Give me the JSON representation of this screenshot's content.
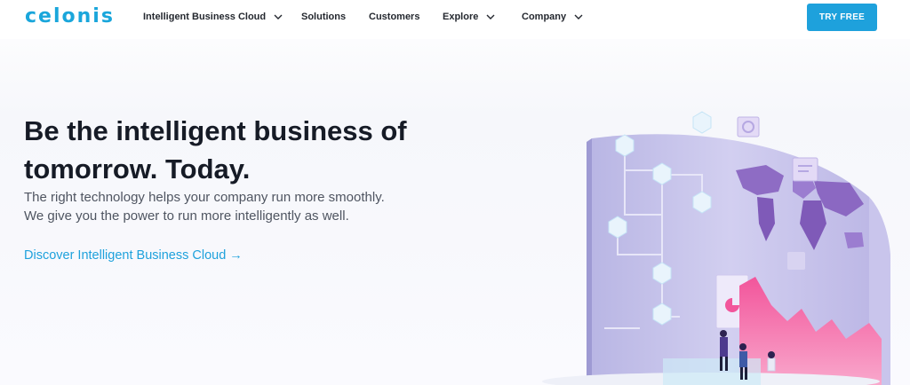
{
  "brand": {
    "logo_text": "celonis",
    "accent": "#1ea1dc"
  },
  "nav": {
    "items": [
      {
        "label": "Intelligent Business Cloud",
        "has_dropdown": true
      },
      {
        "label": "Solutions",
        "has_dropdown": false
      },
      {
        "label": "Customers",
        "has_dropdown": false
      },
      {
        "label": "Explore",
        "has_dropdown": true
      },
      {
        "label": "Company",
        "has_dropdown": true
      }
    ],
    "cta_label": "TRY FREE"
  },
  "hero": {
    "headline_line1": "Be the intelligent business of",
    "headline_line2": "tomorrow. Today.",
    "sub_line1": "The right technology helps your company run more smoothly.",
    "sub_line2": "We give you the power to run more intelligently as well.",
    "link_label": "Discover Intelligent Business Cloud →"
  },
  "illustration": {
    "name": "data-world-map-illustration"
  }
}
